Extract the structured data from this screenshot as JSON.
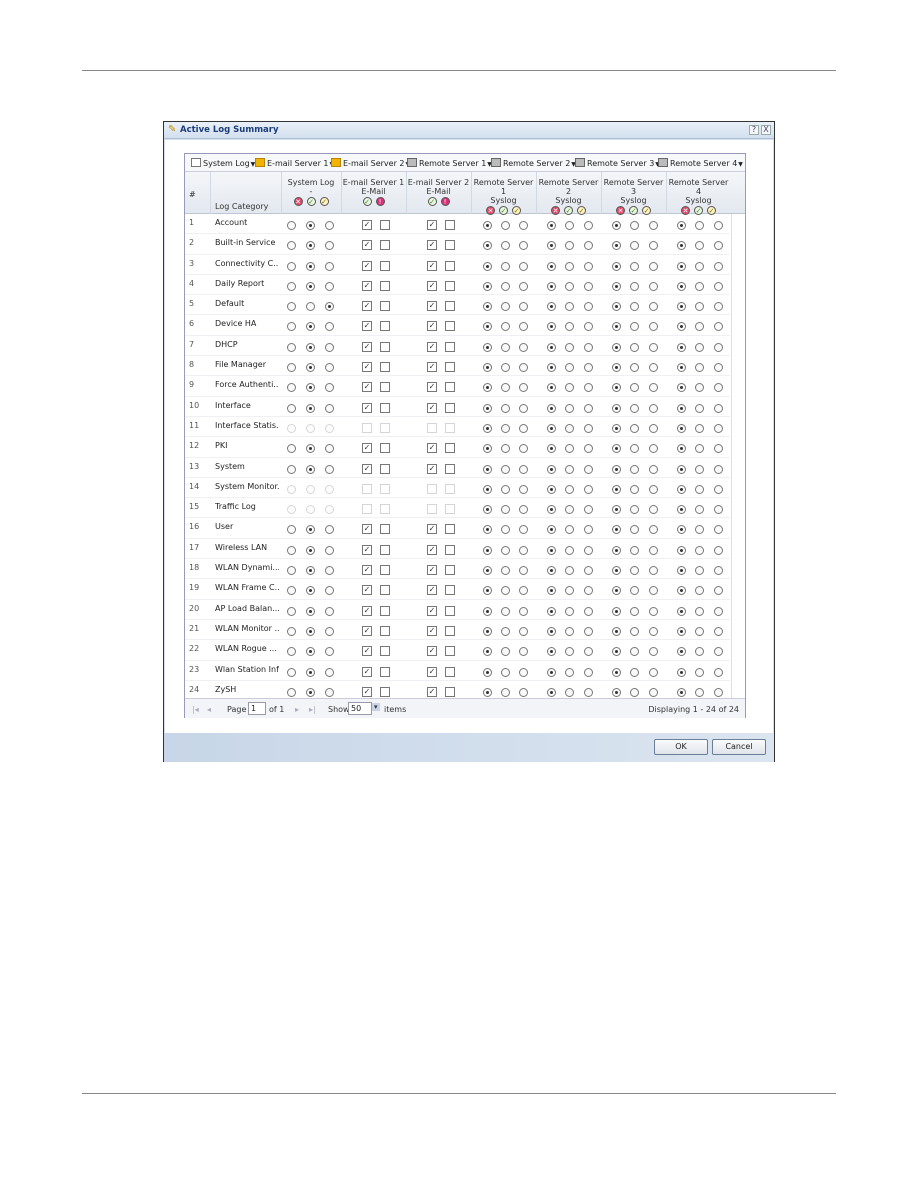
{
  "dialog": {
    "title": "Active Log Summary",
    "help": "?",
    "close": "X"
  },
  "toolbar": [
    "System Log",
    "E-mail Server 1",
    "E-mail Server 2",
    "Remote Server 1",
    "Remote Server 2",
    "Remote Server 3",
    "Remote Server 4"
  ],
  "toolbar_icons": [
    "document-icon",
    "mail-icon",
    "mail-icon",
    "server-icon",
    "server-icon",
    "server-icon",
    "server-icon"
  ],
  "header": {
    "num": "#",
    "category": "Log Category",
    "columns": [
      {
        "name": "System Log",
        "sub": "-",
        "icons": [
          "disable",
          "normal",
          "debug"
        ]
      },
      {
        "name": "E-mail Server 1",
        "sub": "E-Mail",
        "icons": [
          "normal",
          "alert"
        ]
      },
      {
        "name": "E-mail Server 2",
        "sub": "E-Mail",
        "icons": [
          "normal",
          "alert"
        ]
      },
      {
        "name": "Remote Server 1",
        "sub": "Syslog",
        "icons": [
          "disable",
          "normal",
          "debug"
        ]
      },
      {
        "name": "Remote Server 2",
        "sub": "Syslog",
        "icons": [
          "disable",
          "normal",
          "debug"
        ]
      },
      {
        "name": "Remote Server 3",
        "sub": "Syslog",
        "icons": [
          "disable",
          "normal",
          "debug"
        ]
      },
      {
        "name": "Remote Server 4",
        "sub": "Syslog",
        "icons": [
          "disable",
          "normal",
          "debug"
        ]
      }
    ]
  },
  "rows": [
    {
      "n": "1",
      "cat": "Account",
      "sys": 1
    },
    {
      "n": "2",
      "cat": "Built-in Service",
      "sys": 1
    },
    {
      "n": "3",
      "cat": "Connectivity C...",
      "sys": 1
    },
    {
      "n": "4",
      "cat": "Daily Report",
      "sys": 1
    },
    {
      "n": "5",
      "cat": "Default",
      "sys": 2
    },
    {
      "n": "6",
      "cat": "Device HA",
      "sys": 1
    },
    {
      "n": "7",
      "cat": "DHCP",
      "sys": 1
    },
    {
      "n": "8",
      "cat": "File Manager",
      "sys": 1
    },
    {
      "n": "9",
      "cat": "Force Authenti...",
      "sys": 1
    },
    {
      "n": "10",
      "cat": "Interface",
      "sys": 1
    },
    {
      "n": "11",
      "cat": "Interface Statis...",
      "sys": null,
      "disabled": true
    },
    {
      "n": "12",
      "cat": "PKI",
      "sys": 1
    },
    {
      "n": "13",
      "cat": "System",
      "sys": 1
    },
    {
      "n": "14",
      "cat": "System Monitor...",
      "sys": null,
      "disabled": true
    },
    {
      "n": "15",
      "cat": "Traffic Log",
      "sys": null,
      "disabled": true
    },
    {
      "n": "16",
      "cat": "User",
      "sys": 1
    },
    {
      "n": "17",
      "cat": "Wireless LAN",
      "sys": 1
    },
    {
      "n": "18",
      "cat": "WLAN Dynami...",
      "sys": 1
    },
    {
      "n": "19",
      "cat": "WLAN Frame C...",
      "sys": 1
    },
    {
      "n": "20",
      "cat": "AP Load Balan...",
      "sys": 1
    },
    {
      "n": "21",
      "cat": "WLAN Monitor ...",
      "sys": 1
    },
    {
      "n": "22",
      "cat": "WLAN Rogue ...",
      "sys": 1
    },
    {
      "n": "23",
      "cat": "Wlan Station Info",
      "sys": 1
    },
    {
      "n": "24",
      "cat": "ZySH",
      "sys": 1
    }
  ],
  "row_defaults": {
    "email1": [
      true,
      false
    ],
    "email2": [
      true,
      false
    ],
    "remote_selected": [
      0,
      0,
      0,
      0
    ]
  },
  "pager": {
    "page_label": "Page",
    "page": "1",
    "of": "of 1",
    "show": "Show",
    "per_page": "50",
    "items": "items",
    "displaying": "Displaying 1 - 24 of 24"
  },
  "buttons": {
    "ok": "OK",
    "cancel": "Cancel"
  }
}
